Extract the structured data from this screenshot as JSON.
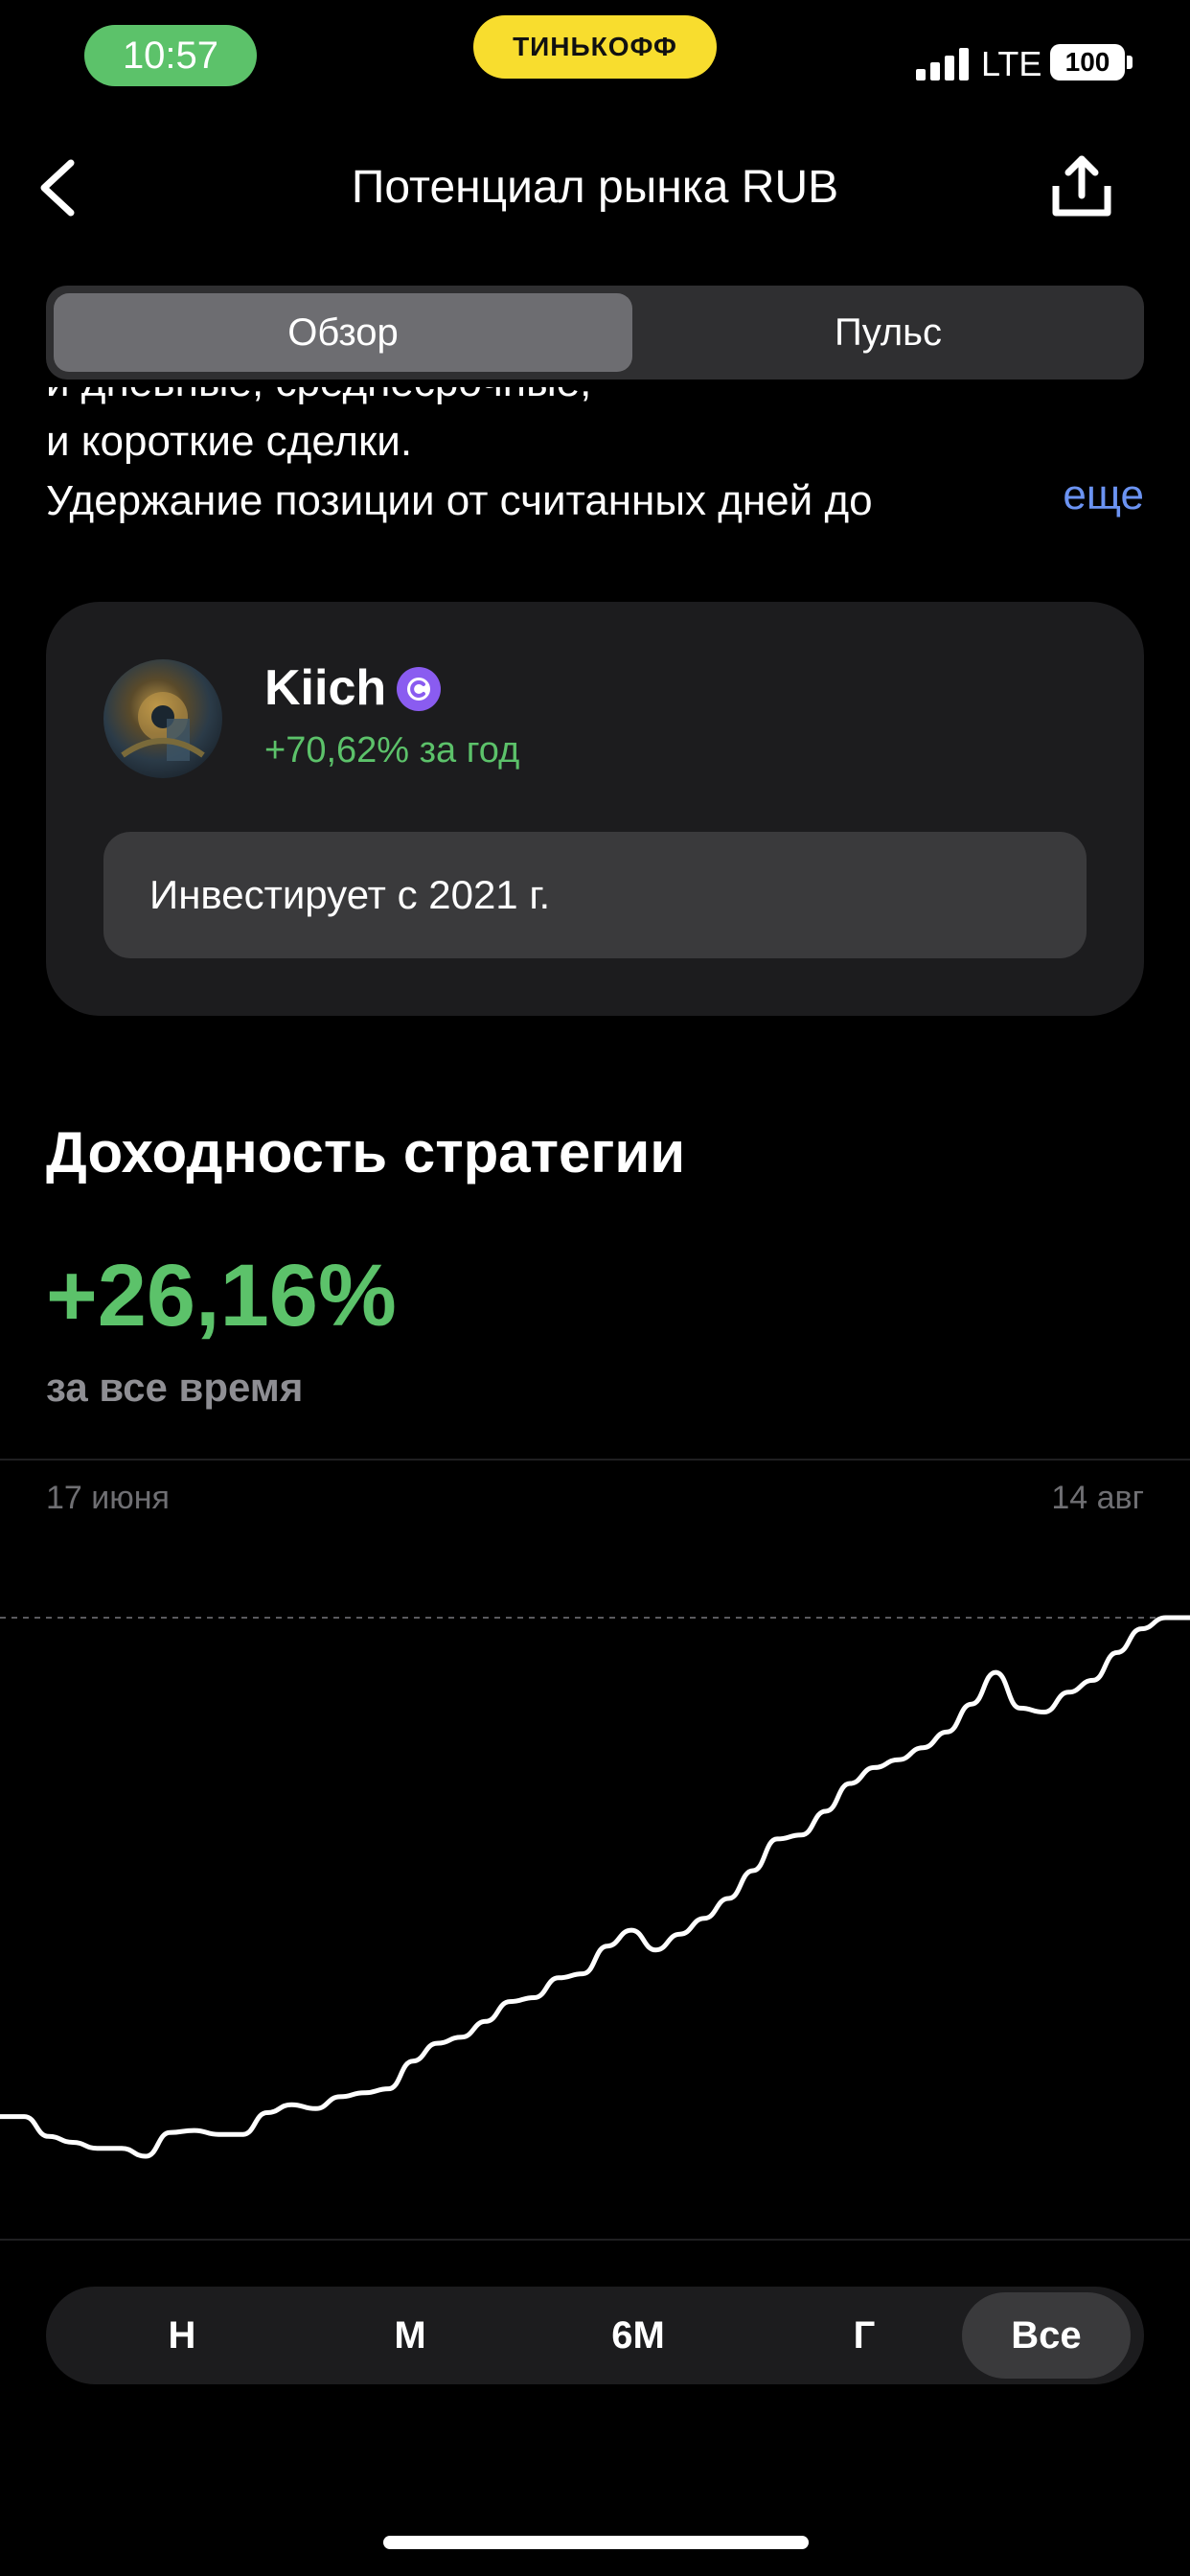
{
  "status_bar": {
    "time": "10:57",
    "carrier_badge": "ТИНЬКОФФ",
    "network": "LTE",
    "battery": "100"
  },
  "header": {
    "title": "Потенциал рынка RUB"
  },
  "tabs": [
    {
      "label": "Обзор",
      "active": true
    },
    {
      "label": "Пульс",
      "active": false
    }
  ],
  "description": {
    "line_partial": "и дневные, среднесрочные,",
    "line1": "и короткие сделки.",
    "line2": "Удержание позиции от считанных дней до",
    "more_label": "еще"
  },
  "author": {
    "name": "Kiich",
    "yield_text": "+70,62% за год",
    "invest_since": "Инвестирует с 2021 г."
  },
  "strategy": {
    "section_title": "Доходность стратегии",
    "yield_value": "+26,16%",
    "period_label": "за все время"
  },
  "chart_data": {
    "type": "line",
    "x_start_label": "17 июня",
    "x_end_label": "14 авг",
    "values": [
      1.0,
      1.0,
      0.0,
      -0.3,
      -0.6,
      -0.6,
      -1.0,
      0.2,
      0.3,
      0.1,
      0.1,
      1.2,
      1.6,
      1.4,
      2.0,
      2.2,
      2.4,
      3.8,
      4.7,
      5.0,
      5.8,
      6.8,
      7.0,
      8.0,
      8.2,
      9.6,
      10.4,
      9.4,
      10.2,
      11.0,
      12.0,
      13.4,
      15.0,
      15.2,
      16.4,
      17.8,
      18.6,
      19.0,
      19.6,
      20.4,
      21.8,
      23.4,
      21.6,
      21.4,
      22.4,
      23.0,
      24.4,
      25.6,
      26.16,
      26.16
    ],
    "y_unit": "%",
    "line_color": "#ffffff",
    "reference_line": "dashed at current value"
  },
  "period_selector": [
    {
      "label": "Н",
      "active": false
    },
    {
      "label": "М",
      "active": false
    },
    {
      "label": "6М",
      "active": false
    },
    {
      "label": "Г",
      "active": false
    },
    {
      "label": "Все",
      "active": true
    }
  ],
  "colors": {
    "positive": "#5cc26a",
    "link": "#6b93f2",
    "badge": "#8a5cf0",
    "carrier": "#f8dd2e"
  }
}
